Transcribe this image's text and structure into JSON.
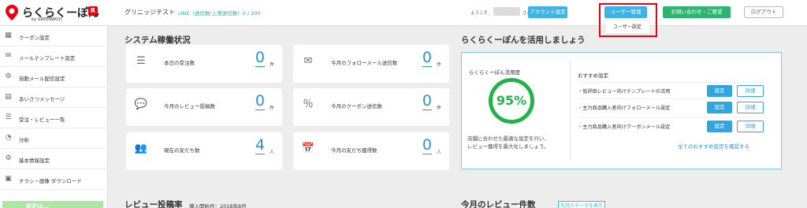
{
  "header": {
    "logo_text": "らくらくーぽん",
    "logo_badge": "R",
    "logo_sub": "by GREENWICH",
    "shop_name": "グリニッジテスト",
    "line_status": "LINE（送信数/上限送信数）0 / 200",
    "welcome_prefix": "ようこそ、",
    "welcome_suffix": "さん",
    "account_button": "アカウント設定",
    "user_manage_button": "ユーザー管理",
    "user_settings_item": "ユーザー設定",
    "contact_button": "お問い合わせ・ご要望",
    "logout_button": "ログアウト"
  },
  "sidebar": {
    "items": [
      {
        "label": "クーポン設定",
        "icon": "coupon-icon"
      },
      {
        "label": "メールテンプレート設定",
        "icon": "mail-icon"
      },
      {
        "label": "自動メール配信設定",
        "icon": "auto-mail-icon"
      },
      {
        "label": "あいさつメッセージ",
        "icon": "greeting-icon"
      },
      {
        "label": "受注・レビュー一覧",
        "icon": "list-icon"
      },
      {
        "label": "分析",
        "icon": "pie-chart-icon"
      },
      {
        "label": "基本情報設定",
        "icon": "gear-icon"
      },
      {
        "label": "チラシ・画像 ダウンロード",
        "icon": "image-icon"
      }
    ],
    "banner_text": "設定は..."
  },
  "main": {
    "status_title": "システム稼働状況",
    "cards": [
      {
        "label": "本日の受注数",
        "value": "0",
        "unit": "件"
      },
      {
        "label": "今月のフォローメール送信数",
        "value": "0",
        "unit": "件"
      },
      {
        "label": "今月のレビュー投稿数",
        "value": "0",
        "unit": "件"
      },
      {
        "label": "今月のクーポン送信数",
        "value": "0",
        "unit": "件"
      },
      {
        "label": "現在の友だち数",
        "value": "4",
        "unit": "人"
      },
      {
        "label": "今月の友だち獲得数",
        "value": "0",
        "unit": "人"
      }
    ],
    "utilize_title": "らくらくーぽんを活用しましょう",
    "utilize": {
      "rate_label": "らくらくーぽん活用度",
      "rate_value": "95%",
      "desc_line1": "店舗に合わせた最適な設定を行い、",
      "desc_line2": "レビュー獲得を最大化しましょう。",
      "rec_title": "おすすめ設定",
      "recommendations": [
        {
          "label": "・低評価レビュー向けテンプレートの活用",
          "set": "設定",
          "detail": "詳細"
        },
        {
          "label": "・主力商品購入者向けフォローメール設定",
          "set": "設定",
          "detail": "詳細"
        },
        {
          "label": "・主力商品購入者向けクーポンメール設定",
          "set": "設定",
          "detail": "詳細"
        }
      ],
      "all_link": "全てのおすすめ設定を確認する"
    },
    "review_rate_title": "レビュー投稿率",
    "review_rate_note": "導入開始月：2018年8月",
    "review_count_title": "今月のレビュー件数",
    "last_month_button": "先月のデータを表示"
  }
}
